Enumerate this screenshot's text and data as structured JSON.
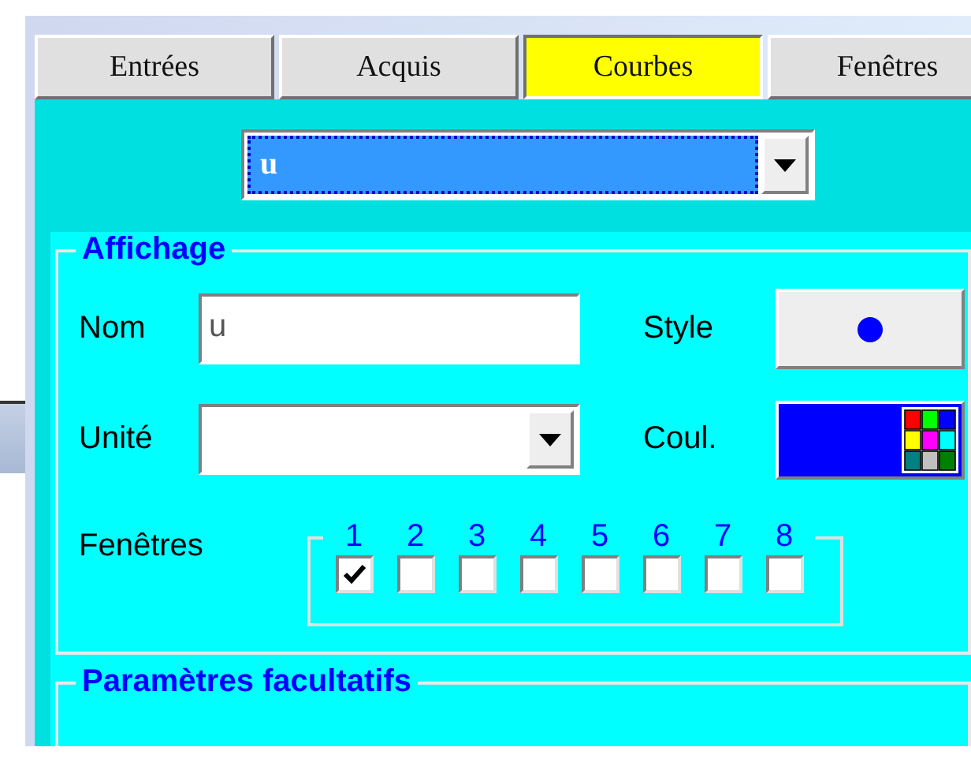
{
  "tabs": [
    {
      "label": "Entrées",
      "selected": false
    },
    {
      "label": "Acquis",
      "selected": false
    },
    {
      "label": "Courbes",
      "selected": true
    },
    {
      "label": "Fenêtres",
      "selected": false
    }
  ],
  "curve_select": {
    "value": "u"
  },
  "display_group": {
    "title": "Affichage",
    "name_label": "Nom",
    "name_value": "u",
    "style_label": "Style",
    "unit_label": "Unité",
    "color_label": "Coul.",
    "color": "#0000ff",
    "windows_label": "Fenêtres",
    "windows": [
      {
        "label": "1",
        "checked": true
      },
      {
        "label": "2",
        "checked": false
      },
      {
        "label": "3",
        "checked": false
      },
      {
        "label": "4",
        "checked": false
      },
      {
        "label": "5",
        "checked": false
      },
      {
        "label": "6",
        "checked": false
      },
      {
        "label": "7",
        "checked": false
      },
      {
        "label": "8",
        "checked": false
      }
    ]
  },
  "optional_group": {
    "title": "Paramètres facultatifs"
  }
}
